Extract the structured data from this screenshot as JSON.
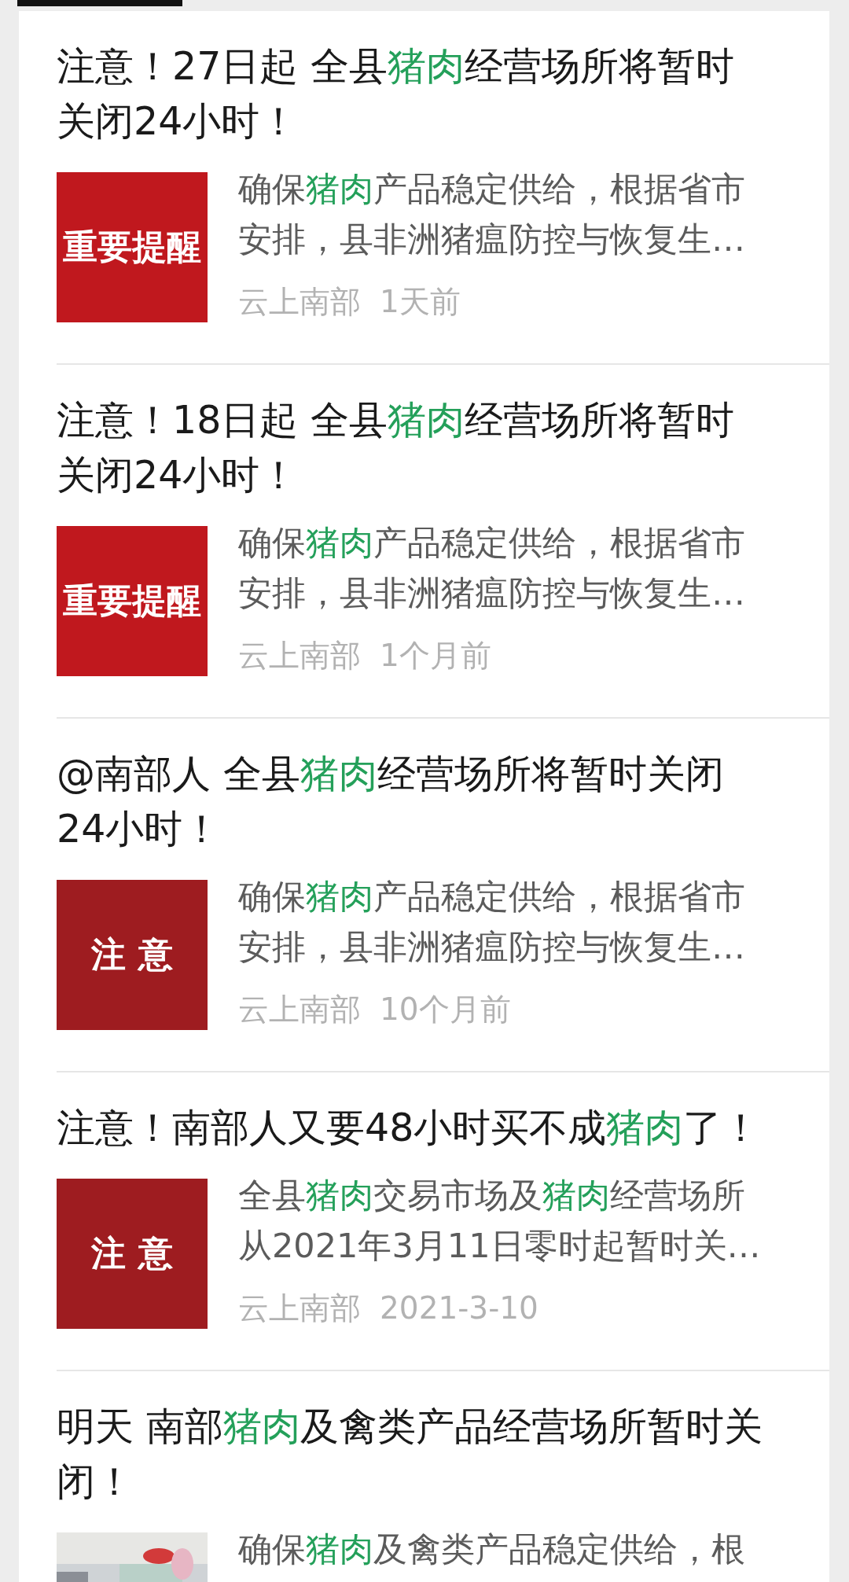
{
  "items": [
    {
      "title_lines": [
        [
          {
            "text": "注意！27日起 全县"
          },
          {
            "text": "猪肉",
            "highlight": true
          },
          {
            "text": "经营场所将暂时"
          }
        ],
        [
          {
            "text": "关闭24小时！"
          }
        ]
      ],
      "thumb": {
        "kind": "banner",
        "text": "重要提醒",
        "color": "#c0181e"
      },
      "snippet_lines": [
        [
          {
            "text": "确保"
          },
          {
            "text": "猪肉",
            "highlight": true
          },
          {
            "text": "产品稳定供给，根据省市"
          }
        ],
        [
          {
            "text": "安排，县非洲猪瘟防控与恢复生…"
          }
        ]
      ],
      "source": "云上南部",
      "time": "1天前"
    },
    {
      "title_lines": [
        [
          {
            "text": "注意！18日起 全县"
          },
          {
            "text": "猪肉",
            "highlight": true
          },
          {
            "text": "经营场所将暂时"
          }
        ],
        [
          {
            "text": "关闭24小时！"
          }
        ]
      ],
      "thumb": {
        "kind": "banner",
        "text": "重要提醒",
        "color": "#c0181e"
      },
      "snippet_lines": [
        [
          {
            "text": "确保"
          },
          {
            "text": "猪肉",
            "highlight": true
          },
          {
            "text": "产品稳定供给，根据省市"
          }
        ],
        [
          {
            "text": "安排，县非洲猪瘟防控与恢复生…"
          }
        ]
      ],
      "source": "云上南部",
      "time": "1个月前"
    },
    {
      "title_lines": [
        [
          {
            "text": "@南部人 全县"
          },
          {
            "text": "猪肉",
            "highlight": true
          },
          {
            "text": "经营场所将暂时关闭"
          }
        ],
        [
          {
            "text": "24小时！"
          }
        ]
      ],
      "thumb": {
        "kind": "banner",
        "text": "注 意",
        "color": "#9e1c20"
      },
      "snippet_lines": [
        [
          {
            "text": "确保"
          },
          {
            "text": "猪肉",
            "highlight": true
          },
          {
            "text": "产品稳定供给，根据省市"
          }
        ],
        [
          {
            "text": "安排，县非洲猪瘟防控与恢复生…"
          }
        ]
      ],
      "source": "云上南部",
      "time": "10个月前"
    },
    {
      "title_lines": [
        [
          {
            "text": "注意！南部人又要48小时买不成"
          },
          {
            "text": "猪肉",
            "highlight": true
          },
          {
            "text": "了！"
          }
        ]
      ],
      "thumb": {
        "kind": "banner",
        "text": "注 意",
        "color": "#9e1c20"
      },
      "snippet_lines": [
        [
          {
            "text": "全县"
          },
          {
            "text": "猪肉",
            "highlight": true
          },
          {
            "text": "交易市场及"
          },
          {
            "text": "猪肉",
            "highlight": true
          },
          {
            "text": "经营场所"
          }
        ],
        [
          {
            "text": "从2021年3月11日零时起暂时关…"
          }
        ]
      ],
      "source": "云上南部",
      "time": "2021-3-10"
    },
    {
      "title_lines": [
        [
          {
            "text": "明天 南部"
          },
          {
            "text": "猪肉",
            "highlight": true
          },
          {
            "text": "及禽类产品经营场所暂时关"
          }
        ],
        [
          {
            "text": "闭！"
          }
        ]
      ],
      "thumb": {
        "kind": "picture"
      },
      "snippet_lines": [
        [
          {
            "text": "确保"
          },
          {
            "text": "猪肉",
            "highlight": true
          },
          {
            "text": "及禽类产品稳定供给，根"
          }
        ]
      ]
    }
  ]
}
